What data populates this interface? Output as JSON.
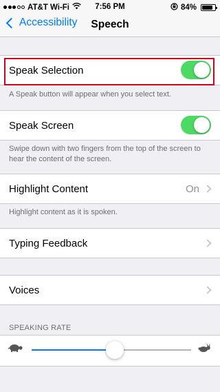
{
  "status_bar": {
    "carrier": "AT&T Wi-Fi",
    "time": "7:56 PM",
    "battery_percent": "84%",
    "battery_level": 0.84,
    "signal_bars_filled": 3,
    "signal_bars_total": 5
  },
  "nav": {
    "back_label": "Accessibility",
    "title": "Speech"
  },
  "cells": {
    "speak_selection": {
      "label": "Speak Selection",
      "on": true
    },
    "speak_selection_footer": "A Speak button will appear when you select text.",
    "speak_screen": {
      "label": "Speak Screen",
      "on": true
    },
    "speak_screen_footer": "Swipe down with two fingers from the top of the screen to hear the content of the screen.",
    "highlight_content": {
      "label": "Highlight Content",
      "value": "On"
    },
    "highlight_footer": "Highlight content as it is spoken.",
    "typing_feedback": {
      "label": "Typing Feedback"
    },
    "voices": {
      "label": "Voices"
    }
  },
  "speaking_rate": {
    "header": "SPEAKING RATE",
    "value_fraction": 0.52
  },
  "colors": {
    "accent": "#007aff",
    "toggle_on": "#4cd964",
    "highlight_border": "#d0021b"
  },
  "icons": {
    "back": "chevron-left-icon",
    "disclosure": "chevron-right-icon",
    "slow": "turtle-icon",
    "fast": "hare-icon"
  }
}
